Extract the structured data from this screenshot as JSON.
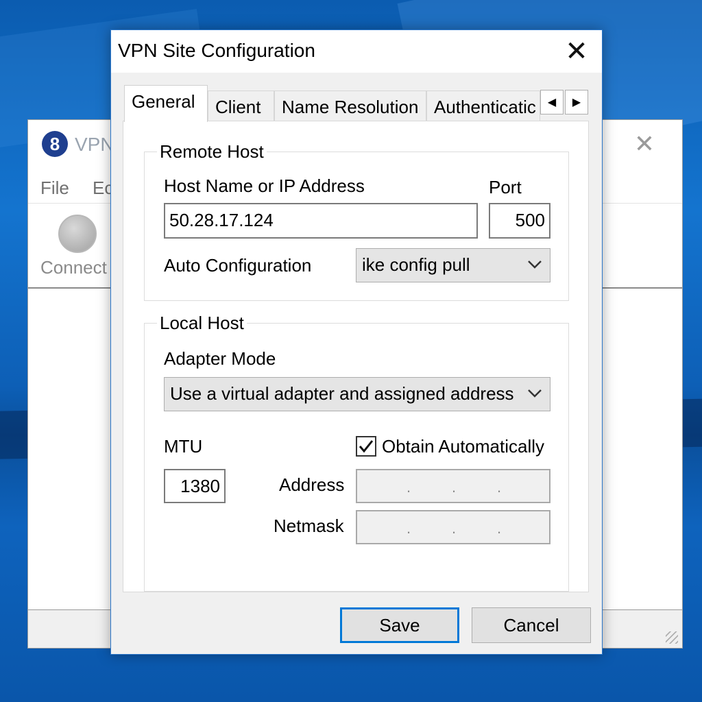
{
  "background_window": {
    "title_fragment": "VPN",
    "menu": [
      "File",
      "Ec"
    ],
    "toolbar_connect_label": "Connect"
  },
  "dialog": {
    "title": "VPN Site Configuration",
    "tabs": [
      "General",
      "Client",
      "Name Resolution",
      "Authenticatic"
    ],
    "active_tab": "General",
    "remote_host": {
      "group_label": "Remote Host",
      "host_label": "Host Name or IP Address",
      "host_value": "50.28.17.124",
      "port_label": "Port",
      "port_value": "500",
      "auto_config_label": "Auto Configuration",
      "auto_config_value": "ike config pull"
    },
    "local_host": {
      "group_label": "Local Host",
      "adapter_mode_label": "Adapter Mode",
      "adapter_mode_value": "Use a virtual adapter and assigned address",
      "mtu_label": "MTU",
      "mtu_value": "1380",
      "obtain_auto_label": "Obtain Automatically",
      "obtain_auto_checked": true,
      "address_label": "Address",
      "netmask_label": "Netmask"
    },
    "buttons": {
      "save": "Save",
      "cancel": "Cancel"
    }
  },
  "colors": {
    "accent": "#0078d7",
    "dialog_bg": "#f0f0f0",
    "desktop": "#1474cf"
  }
}
